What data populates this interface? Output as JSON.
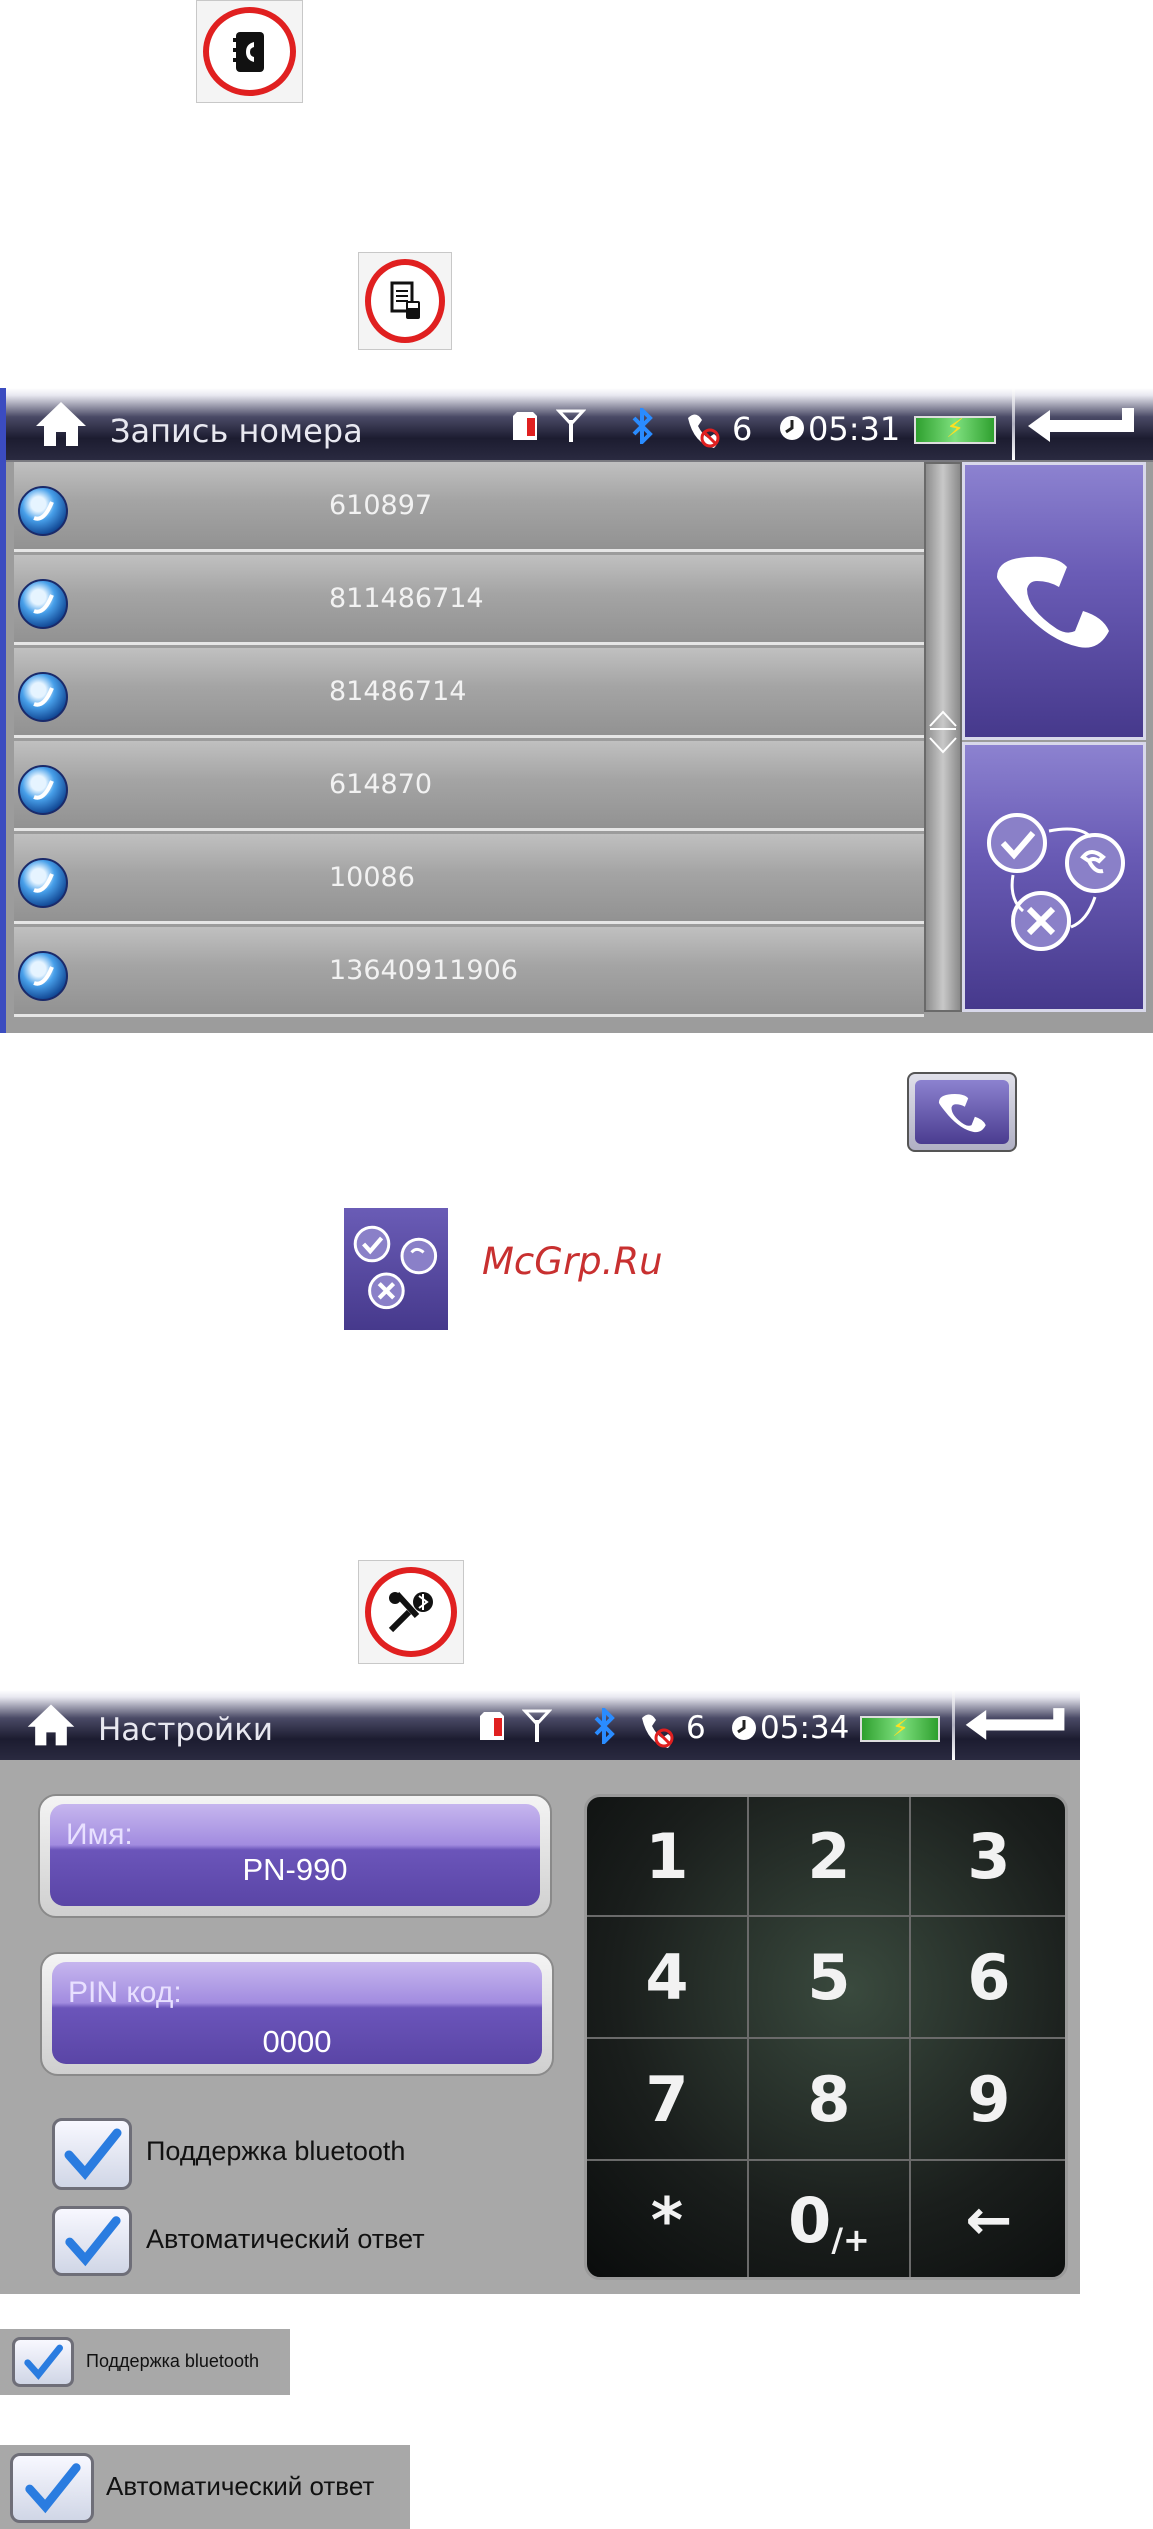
{
  "icons": {
    "phonebook": "phonebook-icon",
    "call_log": "call-log-icon",
    "settings": "settings-tools-icon"
  },
  "call_log_screen": {
    "title": "Запись номера",
    "status": {
      "missed_count": "6",
      "time": "05:31"
    },
    "entries": [
      {
        "number": "610897"
      },
      {
        "number": "811486714"
      },
      {
        "number": "81486714"
      },
      {
        "number": "614870"
      },
      {
        "number": "10086"
      },
      {
        "number": "13640911906"
      }
    ]
  },
  "watermark": "McGrp.Ru",
  "settings_screen": {
    "title": "Настройки",
    "status": {
      "missed_count": "6",
      "time": "05:34"
    },
    "name_field": {
      "label": "Имя:",
      "value": "PN-990"
    },
    "pin_field": {
      "label": "PIN код:",
      "value": "0000"
    },
    "checkboxes": [
      {
        "label": "Поддержка bluetooth",
        "checked": true
      },
      {
        "label": "Автоматический ответ",
        "checked": true
      }
    ],
    "keypad": {
      "keys": [
        "1",
        "2",
        "3",
        "4",
        "5",
        "6",
        "7",
        "8",
        "9",
        "*",
        "0",
        "←"
      ],
      "zero_sub": "/+"
    }
  },
  "zoom_labels": {
    "bluetooth": "Поддержка bluetooth",
    "auto_answer": "Автоматический ответ"
  },
  "colors": {
    "accent_red": "#e02020",
    "purple": "#5a45a6",
    "battery_green": "#40c040"
  }
}
